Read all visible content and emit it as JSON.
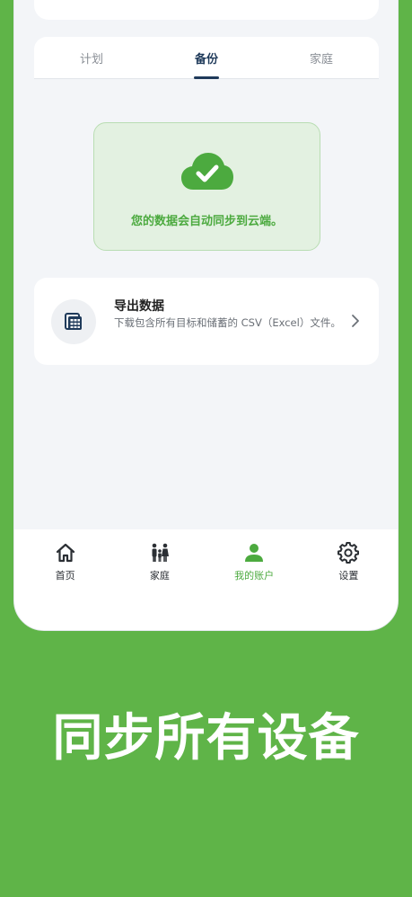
{
  "tabs": [
    {
      "label": "计划"
    },
    {
      "label": "备份"
    },
    {
      "label": "家庭"
    }
  ],
  "active_tab": 1,
  "sync_notice": {
    "icon": "cloud-check-icon",
    "text": "您的数据会自动同步到云端。",
    "color": "#4caa3f"
  },
  "export": {
    "icon": "spreadsheet-icon",
    "title": "导出数据",
    "description": "下载包含所有目标和储蓄的 CSV（Excel）文件。"
  },
  "nav": [
    {
      "label": "首页",
      "icon": "home-icon"
    },
    {
      "label": "家庭",
      "icon": "family-icon"
    },
    {
      "label": "我的账户",
      "icon": "account-icon"
    },
    {
      "label": "设置",
      "icon": "gear-icon"
    }
  ],
  "slogan": "同步所有设备",
  "colors": {
    "background": "#5fb448",
    "accent": "#4caa3f",
    "primary": "#1f3a5a"
  }
}
